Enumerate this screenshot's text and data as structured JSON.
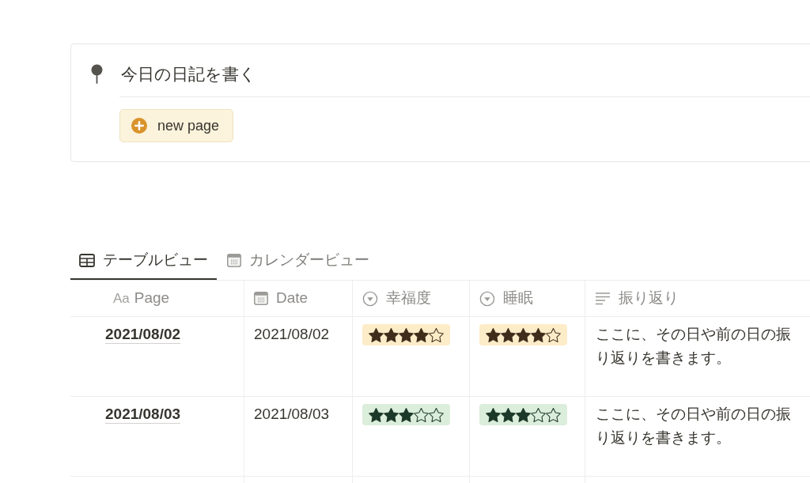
{
  "callout": {
    "title": "今日の日記を書く",
    "button": "new page"
  },
  "tabs": [
    {
      "label": "テーブルビュー",
      "kind": "table",
      "selected": true
    },
    {
      "label": "カレンダービュー",
      "kind": "calendar",
      "selected": false
    }
  ],
  "table": {
    "columns": [
      {
        "kind": "title",
        "icon_text": "Aa",
        "label": "Page"
      },
      {
        "kind": "date",
        "label": "Date"
      },
      {
        "kind": "select",
        "label": "幸福度"
      },
      {
        "kind": "select",
        "label": "睡眠"
      },
      {
        "kind": "text",
        "label": "振り返り"
      }
    ],
    "rows": [
      {
        "page": "2021/08/02",
        "date": "2021/08/02",
        "happiness": {
          "stars": 4,
          "color": "#fdecc8"
        },
        "sleep": {
          "stars": 4,
          "color": "#fdecc8"
        },
        "reflection": "ここに、その日や前の日の振り返りを書きます。"
      },
      {
        "page": "2021/08/03",
        "date": "2021/08/03",
        "happiness": {
          "stars": 3,
          "color": "#dbeddb"
        },
        "sleep": {
          "stars": 3,
          "color": "#dbeddb"
        },
        "reflection": "ここに、その日や前の日の振り返りを書きます。"
      }
    ]
  }
}
